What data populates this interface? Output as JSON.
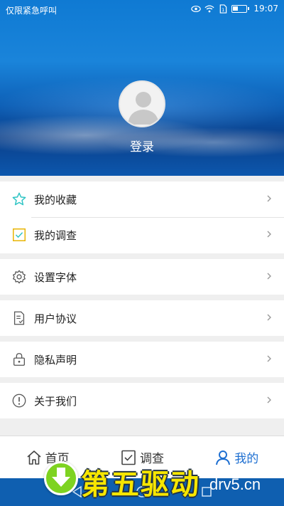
{
  "status_bar": {
    "left_text": "仅限紧急呼叫",
    "time": "19:07"
  },
  "profile": {
    "login_label": "登录"
  },
  "menu": [
    {
      "label": "我的收藏",
      "icon": "star-icon"
    },
    {
      "label": "我的调查",
      "icon": "survey-check-icon"
    },
    {
      "label": "设置字体",
      "icon": "gear-icon"
    },
    {
      "label": "用户协议",
      "icon": "document-icon"
    },
    {
      "label": "隐私声明",
      "icon": "lock-icon"
    },
    {
      "label": "关于我们",
      "icon": "info-icon"
    }
  ],
  "tabs": [
    {
      "label": "首页",
      "icon": "home-icon",
      "active": false
    },
    {
      "label": "调查",
      "icon": "survey-check-icon",
      "active": false
    },
    {
      "label": "我的",
      "icon": "person-icon",
      "active": true
    }
  ],
  "watermark": {
    "title": "第五驱动",
    "url": "drv5.cn"
  },
  "colors": {
    "accent": "#1e6fd1",
    "hero_blue": "#0d5fb6",
    "icon_teal": "#2ec4c4",
    "icon_gold": "#e8b400"
  }
}
